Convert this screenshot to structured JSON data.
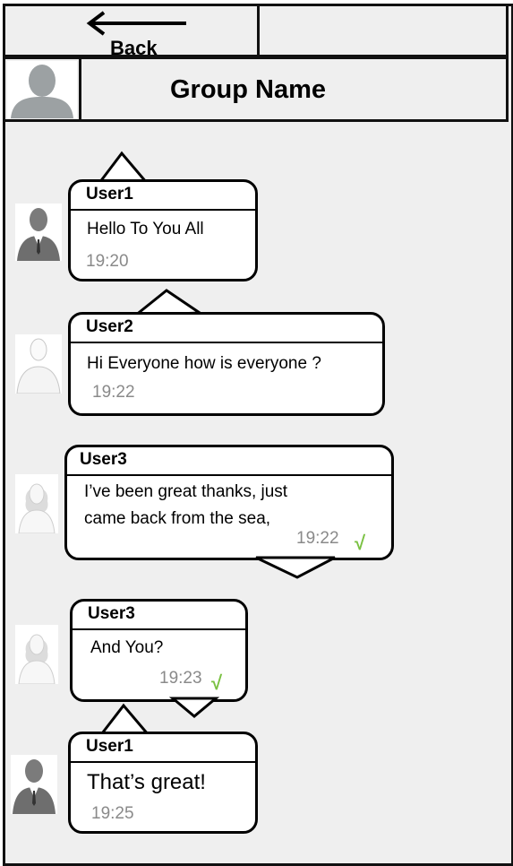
{
  "header": {
    "back_label": "Back"
  },
  "group": {
    "name": "Group Name",
    "avatar_icon": "user-silhouette-icon"
  },
  "messages": [
    {
      "user": "User1",
      "text": "Hello To You All",
      "time": "19:20",
      "avatar": "man-suit-icon"
    },
    {
      "user": "User2",
      "text": "Hi Everyone how is everyone ?",
      "time": "19:22",
      "avatar": "young-man-icon"
    },
    {
      "user": "User3",
      "lines": [
        "I’ve been great thanks, just",
        "came back from the sea,"
      ],
      "time": "19:22",
      "read": "√",
      "avatar": "woman-icon"
    },
    {
      "user": "User3",
      "text": "And You?",
      "time": "19:23",
      "read": "√",
      "avatar": "woman-icon"
    },
    {
      "user": "User1",
      "text": "That’s great!",
      "time": "19:25",
      "avatar": "man-suit-icon"
    }
  ],
  "colors": {
    "frame": "#111111",
    "panel": "#efefef",
    "time": "#8a8a8a",
    "read_tick": "#7ac142"
  }
}
